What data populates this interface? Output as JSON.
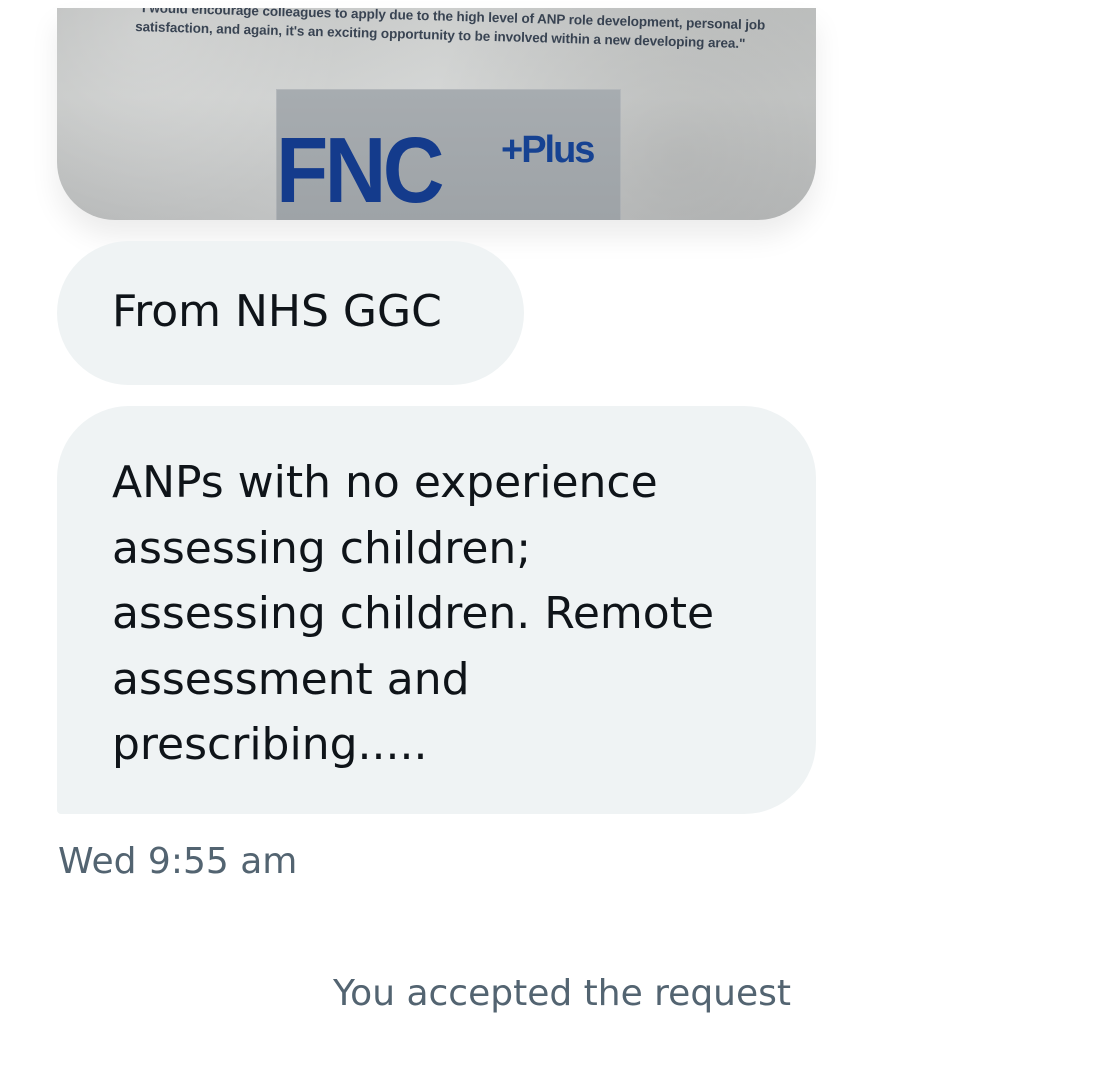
{
  "conversation": {
    "attachment": {
      "quote_text": "\"I would encourage colleagues to apply due to the high level of ANP role development, personal job satisfaction, and again, it's an exciting opportunity to be involved within a new developing area.\"",
      "logo_text": "FNC",
      "logo_plus_text": "+Plus"
    },
    "messages": [
      {
        "text": "From NHS GGC"
      },
      {
        "text": "ANPs with no experience\nassessing children;\nassessing children. Remote\nassessment and\nprescribing....."
      }
    ],
    "timestamp": "Wed 9:55 am",
    "system_message": "You accepted the request"
  },
  "colors": {
    "bubble_background": "#eff3f4",
    "primary_text": "#0f1419",
    "secondary_text": "#536471",
    "logo_blue": "#143b8c"
  }
}
